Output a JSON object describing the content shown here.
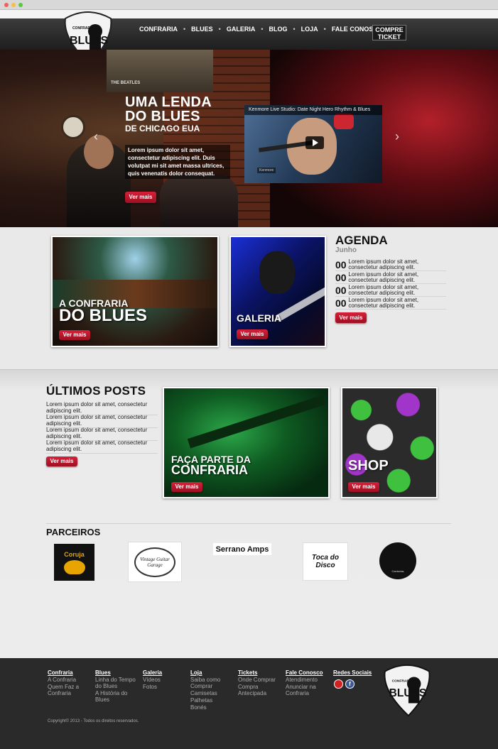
{
  "nav": {
    "items": [
      "CONFRARIA",
      "BLUES",
      "GALERIA",
      "BLOG",
      "LOJA",
      "FALE CONOSCO"
    ],
    "separator": "•",
    "ticket_line1": "COMPRE",
    "ticket_line2": "TICKET"
  },
  "logo": {
    "text": "BLUES",
    "subtext": "CONFRARIA DO"
  },
  "hero": {
    "title_line1": "UMA LENDA",
    "title_line2": "DO BLUES",
    "title_line3": "DE CHICAGO EUA",
    "text": "Lorem ipsum dolor sit amet, consectetur adipiscing elit. Duis volutpat mi sit amet massa ultrices, quis venenatis dolor consequat.",
    "button": "Ver mais",
    "video_title": "Kenmore Live Studio: Date Night Hero Rhythm & Blues",
    "video_badge": "Kenmore",
    "photo_label": "THE BEATLES",
    "arrow_left": "‹",
    "arrow_right": "›"
  },
  "confraria_card": {
    "title_line1": "A CONFRARIA",
    "title_line2": "DO BLUES",
    "button": "Ver mais"
  },
  "galeria_card": {
    "title": "GALERIA",
    "button": "Ver mais"
  },
  "agenda": {
    "title": "AGENDA",
    "month": "Junho",
    "items": [
      {
        "day": "00",
        "text": "Lorem ipsum dolor sit amet, consectetur adipiscing elit."
      },
      {
        "day": "00",
        "text": "Lorem ipsum dolor sit amet, consectetur adipiscing elit."
      },
      {
        "day": "00",
        "text": "Lorem ipsum dolor sit amet, consectetur adipiscing elit."
      },
      {
        "day": "00",
        "text": "Lorem ipsum dolor sit amet, consectetur adipiscing elit."
      }
    ],
    "button": "Ver mais"
  },
  "posts": {
    "title": "ÚLTIMOS POSTS",
    "items": [
      "Lorem ipsum dolor sit amet, consectetur adipiscing elit.",
      "Lorem ipsum dolor sit amet, consectetur adipiscing elit.",
      "Lorem ipsum dolor sit amet, consectetur adipiscing elit.",
      "Lorem ipsum dolor sit amet, consectetur adipiscing elit."
    ],
    "button": "Ver mais"
  },
  "faca_card": {
    "title_line1": "FAÇA PARTE DA",
    "title_line2": "CONFRARIA",
    "button": "Ver mais"
  },
  "shop_card": {
    "title": "SHOP",
    "button": "Ver mais"
  },
  "partners": {
    "title": "PARCEIROS",
    "items": [
      "Coruja",
      "Vintage Guitar Garage",
      "Serrano Amps",
      "Toca do Disco",
      "Cantorias"
    ]
  },
  "footer": {
    "columns": [
      {
        "heading": "Confraria",
        "links": [
          "A Confraria",
          "Quem Faz a Confraria"
        ]
      },
      {
        "heading": "Blues",
        "links": [
          "Linha do Tempo do Blues",
          "A História do Blues"
        ]
      },
      {
        "heading": "Galeria",
        "links": [
          "Vídeos",
          "Fotos"
        ]
      },
      {
        "heading": "Loja",
        "links": [
          "Saiba como Comprar",
          "Camisetas",
          "Palhetas",
          "Bonés"
        ]
      },
      {
        "heading": "Tickets",
        "links": [
          "Onde Comprar",
          "Compra Antecipada"
        ]
      },
      {
        "heading": "Fale Conosco",
        "links": [
          "Atendimento",
          "Anunciar na Confraria"
        ]
      },
      {
        "heading": "Redes Sociais",
        "links": []
      }
    ],
    "copyright": "Copyright© 2013 - Todos os direitos reservados."
  },
  "colors": {
    "accent": "#c8102e",
    "nav_bg": "#2b2b2b",
    "footer_bg": "#2a2a2a"
  }
}
